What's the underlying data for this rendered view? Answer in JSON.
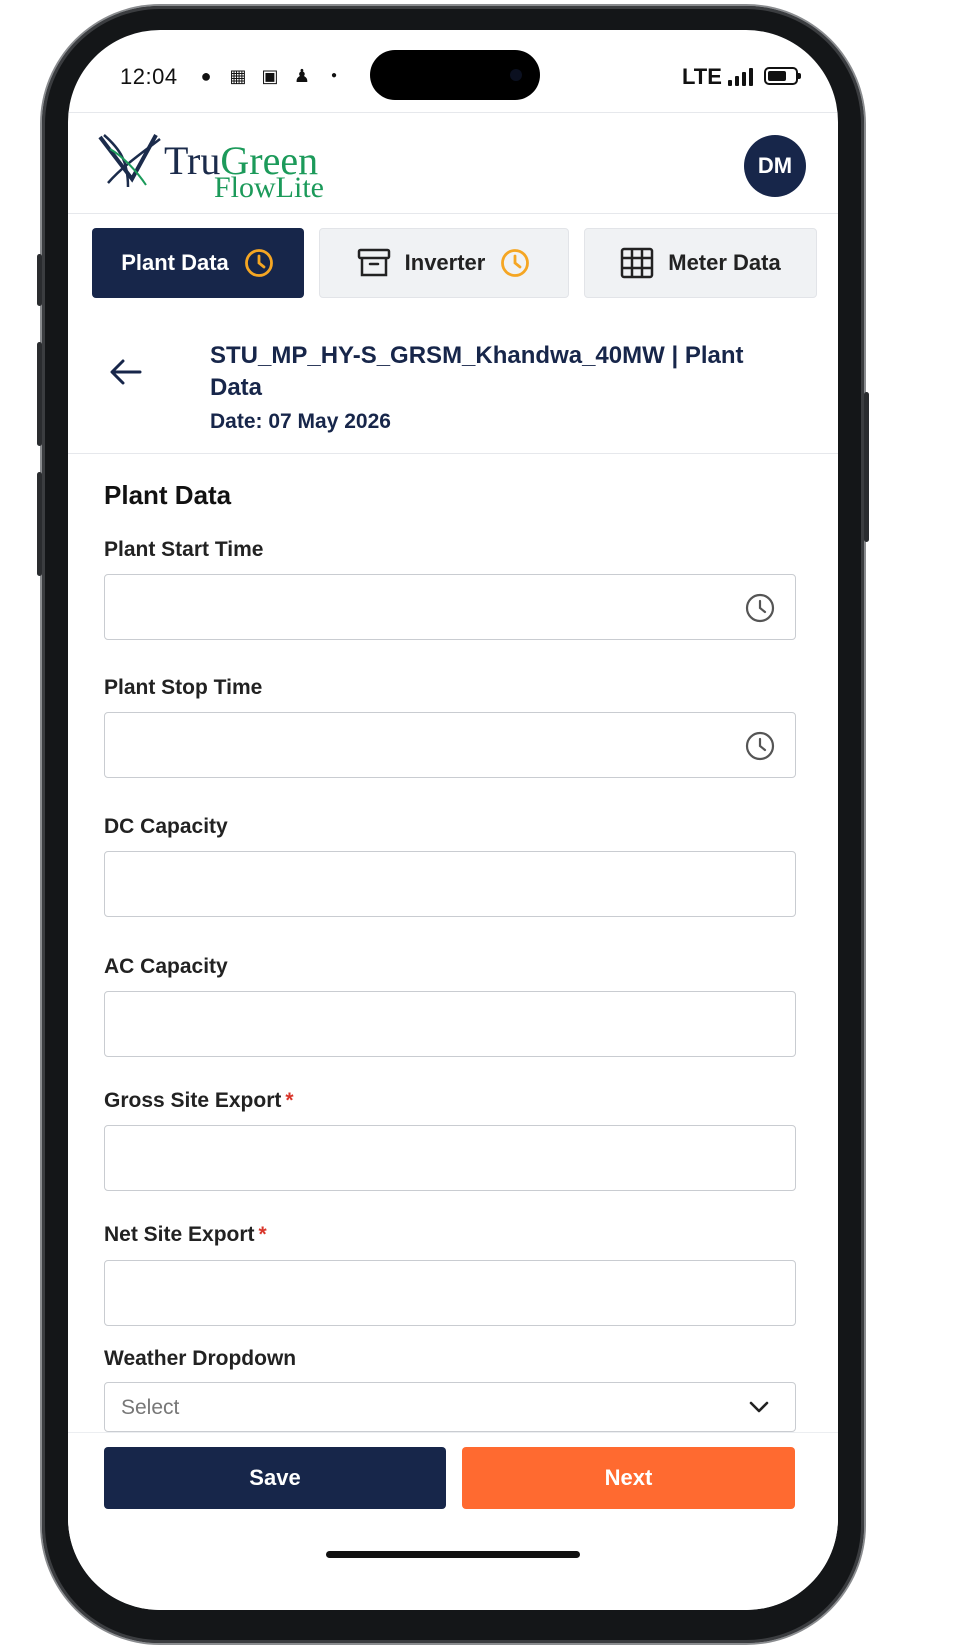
{
  "status_bar": {
    "time": "12:04",
    "network": "LTE"
  },
  "header": {
    "logo": {
      "brand_part1": "Tru",
      "brand_part2": "Green",
      "product": "FlowLite"
    },
    "avatar_initials": "DM"
  },
  "tabs": [
    {
      "label": "Plant Data",
      "icon": "clock-icon",
      "active": true
    },
    {
      "label": "Inverter",
      "icon": "archive-icon",
      "status_icon": "clock-icon",
      "active": false
    },
    {
      "label": "Meter Data",
      "icon": "grid-icon",
      "active": false
    }
  ],
  "page": {
    "title": "STU_MP_HY-S_GRSM_Khandwa_40MW | Plant Data",
    "date": "Date: 07 May 2026"
  },
  "form": {
    "section_title": "Plant Data",
    "fields": {
      "plant_start_time": {
        "label": "Plant Start Time",
        "value": ""
      },
      "plant_stop_time": {
        "label": "Plant Stop Time",
        "value": ""
      },
      "dc_capacity": {
        "label": "DC Capacity",
        "value": ""
      },
      "ac_capacity": {
        "label": "AC Capacity",
        "value": ""
      },
      "gross_site_export": {
        "label": "Gross Site Export",
        "required": "*",
        "value": ""
      },
      "net_site_export": {
        "label": "Net Site Export",
        "required": "*",
        "value": ""
      },
      "weather_dropdown": {
        "label": "Weather Dropdown",
        "selected": "Select"
      }
    }
  },
  "actions": {
    "save_label": "Save",
    "next_label": "Next"
  },
  "colors": {
    "primary": "#17264a",
    "accent": "#ff6a30",
    "brand_green": "#1c9a5a",
    "tab_clock": "#f5a623",
    "required": "#d9362b"
  }
}
